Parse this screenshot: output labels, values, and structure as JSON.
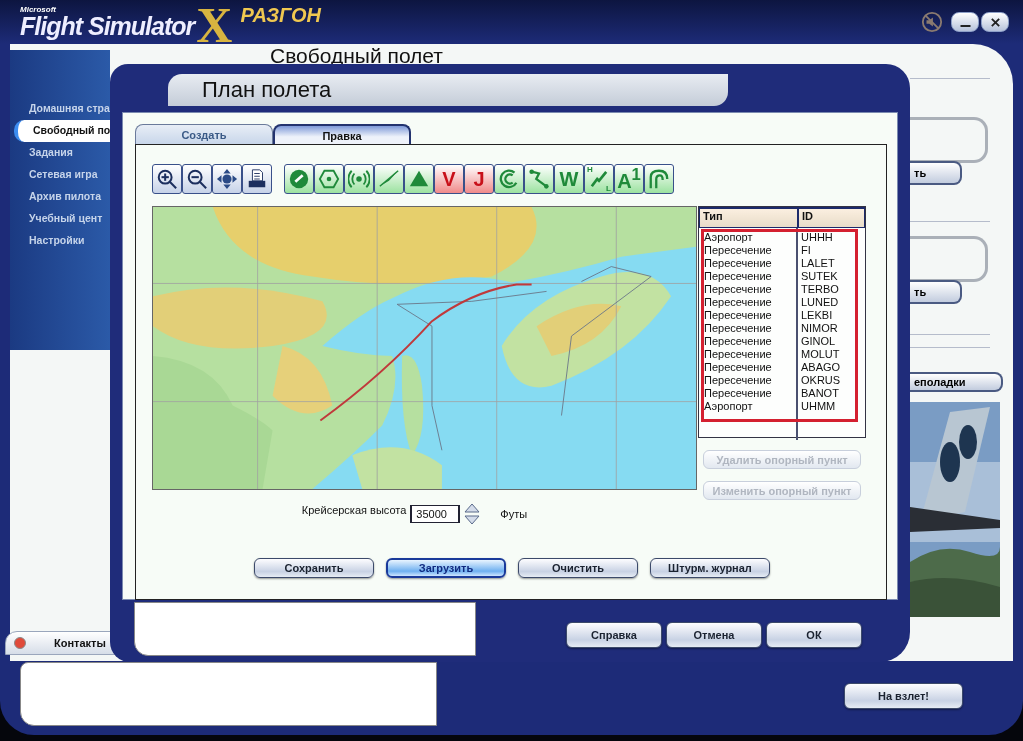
{
  "app": {
    "brand_small": "Microsoft",
    "brand": "Flight Simulator",
    "brand_mark": "X",
    "mode": "РАЗГОН",
    "sound_muted": true
  },
  "page_title": "Свободный полет",
  "sidebar": {
    "items": [
      {
        "label": "Домашняя стра",
        "selected": false
      },
      {
        "label": "Свободный по",
        "selected": true
      },
      {
        "label": "Задания",
        "selected": false
      },
      {
        "label": "Сетевая игра",
        "selected": false
      },
      {
        "label": "Архив пилота",
        "selected": false
      },
      {
        "label": "Учебный цент",
        "selected": false
      },
      {
        "label": "Настройки",
        "selected": false
      }
    ]
  },
  "right_panel": {
    "buttons": [
      "ть",
      "ть",
      "еполадки"
    ]
  },
  "contacts_tab": {
    "label": "Контакты"
  },
  "takeoff_button": "На взлет!",
  "dialog": {
    "title": "План полета",
    "tabs": [
      {
        "label": "Создать",
        "selected": false
      },
      {
        "label": "Правка",
        "selected": true
      }
    ],
    "map_tools": [
      {
        "kind": "zoom-in"
      },
      {
        "kind": "zoom-out"
      },
      {
        "kind": "center"
      },
      {
        "kind": "print"
      }
    ],
    "filters": [
      {
        "kind": "airport",
        "on": true
      },
      {
        "kind": "vor",
        "on": true
      },
      {
        "kind": "ndb",
        "on": true
      },
      {
        "kind": "ils",
        "on": true
      },
      {
        "kind": "triangle",
        "on": true
      },
      {
        "kind": "letter",
        "label": "V",
        "on": false
      },
      {
        "kind": "letter",
        "label": "J",
        "on": false
      },
      {
        "kind": "cycle",
        "on": true
      },
      {
        "kind": "route",
        "on": true
      },
      {
        "kind": "letter",
        "label": "W",
        "on": true
      },
      {
        "kind": "hl",
        "top": "H",
        "bottom": "L",
        "on": true
      },
      {
        "kind": "letter",
        "label": "A$^{1}$",
        "on": true
      },
      {
        "kind": "curves",
        "on": true
      }
    ],
    "waypoints": {
      "columns": [
        "Тип",
        "ID"
      ],
      "highlighted": true,
      "rows": [
        {
          "type": "Аэропорт",
          "id": "UHHH"
        },
        {
          "type": "Пересечение",
          "id": "FI"
        },
        {
          "type": "Пересечение",
          "id": "LALET"
        },
        {
          "type": "Пересечение",
          "id": "SUTEK"
        },
        {
          "type": "Пересечение",
          "id": "TERBO"
        },
        {
          "type": "Пересечение",
          "id": "LUNED"
        },
        {
          "type": "Пересечение",
          "id": "LEKBI"
        },
        {
          "type": "Пересечение",
          "id": "NIMOR"
        },
        {
          "type": "Пересечение",
          "id": "GINOL"
        },
        {
          "type": "Пересечение",
          "id": "MOLUT"
        },
        {
          "type": "Пересечение",
          "id": "ABAGO"
        },
        {
          "type": "Пересечение",
          "id": "OKRUS"
        },
        {
          "type": "Пересечение",
          "id": "BANOT"
        },
        {
          "type": "Аэропорт",
          "id": "UHMM"
        }
      ]
    },
    "waypoint_buttons": [
      {
        "label": "Удалить опорный пункт",
        "disabled": true
      },
      {
        "label": "Изменить опорный пункт",
        "disabled": true
      }
    ],
    "altitude": {
      "label": "Крейсерская высота",
      "value": "35000",
      "unit": "Футы"
    },
    "actions": [
      {
        "label": "Сохранить",
        "default": false
      },
      {
        "label": "Загрузить",
        "default": true
      },
      {
        "label": "Очистить",
        "default": false
      },
      {
        "label": "Штурм. журнал",
        "default": false
      }
    ],
    "footer_buttons": [
      "Справка",
      "Отмена",
      "ОК"
    ]
  }
}
